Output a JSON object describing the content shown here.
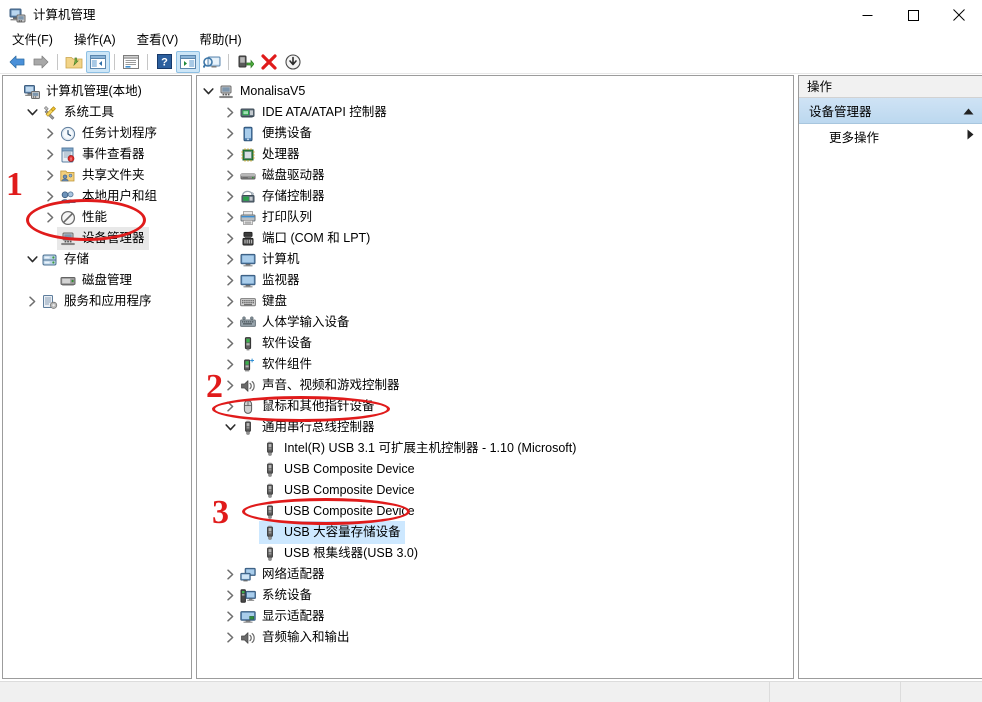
{
  "window": {
    "title": "计算机管理",
    "icon": "computer-management-icon",
    "controls": {
      "minimize": "minimize-icon",
      "maximize": "maximize-icon",
      "close": "close-icon"
    }
  },
  "menubar": {
    "items": [
      {
        "label": "文件(F)",
        "text": "文件(",
        "accel": "F",
        "tail": ")"
      },
      {
        "label": "操作(A)",
        "text": "操作(",
        "accel": "A",
        "tail": ")"
      },
      {
        "label": "查看(V)",
        "text": "查看(",
        "accel": "V",
        "tail": ")"
      },
      {
        "label": "帮助(H)",
        "text": "帮助(",
        "accel": "H",
        "tail": ")"
      }
    ]
  },
  "toolbar": {
    "buttons": [
      {
        "name": "back-icon",
        "state": "normal"
      },
      {
        "name": "forward-icon",
        "state": "normal"
      },
      {
        "name": "separator",
        "state": "sep"
      },
      {
        "name": "up-folder-icon",
        "state": "normal"
      },
      {
        "name": "show-hide-console-tree-icon",
        "state": "active"
      },
      {
        "name": "separator",
        "state": "sep"
      },
      {
        "name": "properties-icon",
        "state": "normal"
      },
      {
        "name": "separator",
        "state": "sep"
      },
      {
        "name": "help-icon",
        "state": "normal"
      },
      {
        "name": "show-hide-action-pane-icon",
        "state": "active"
      },
      {
        "name": "scan-hardware-changes-icon",
        "state": "normal"
      },
      {
        "name": "separator",
        "state": "sep"
      },
      {
        "name": "update-driver-icon",
        "state": "normal"
      },
      {
        "name": "uninstall-device-icon",
        "state": "normal"
      },
      {
        "name": "disable-device-icon",
        "state": "normal"
      }
    ]
  },
  "console_tree": {
    "items": [
      {
        "label": "计算机管理(本地)",
        "depth": 0,
        "chevron": "none",
        "icon": "computer-management-icon",
        "selected": false
      },
      {
        "label": "系统工具",
        "depth": 1,
        "chevron": "down",
        "icon": "system-tools-icon",
        "selected": false
      },
      {
        "label": "任务计划程序",
        "depth": 2,
        "chevron": "right",
        "icon": "task-scheduler-icon",
        "selected": false
      },
      {
        "label": "事件查看器",
        "depth": 2,
        "chevron": "right",
        "icon": "event-viewer-icon",
        "selected": false
      },
      {
        "label": "共享文件夹",
        "depth": 2,
        "chevron": "right",
        "icon": "shared-folders-icon",
        "selected": false
      },
      {
        "label": "本地用户和组",
        "depth": 2,
        "chevron": "right",
        "icon": "local-users-groups-icon",
        "selected": false
      },
      {
        "label": "性能",
        "depth": 2,
        "chevron": "right",
        "icon": "performance-icon",
        "selected": false
      },
      {
        "label": "设备管理器",
        "depth": 2,
        "chevron": "none",
        "icon": "device-manager-icon",
        "selected": true
      },
      {
        "label": "存储",
        "depth": 1,
        "chevron": "down",
        "icon": "storage-icon",
        "selected": false
      },
      {
        "label": "磁盘管理",
        "depth": 2,
        "chevron": "none",
        "icon": "disk-management-icon",
        "selected": false
      },
      {
        "label": "服务和应用程序",
        "depth": 1,
        "chevron": "right",
        "icon": "services-applications-icon",
        "selected": false
      }
    ]
  },
  "device_tree": {
    "items": [
      {
        "label": "MonalisaV5",
        "depth": 0,
        "chevron": "down",
        "icon": "computer-icon",
        "selected": false
      },
      {
        "label": "IDE ATA/ATAPI 控制器",
        "depth": 1,
        "chevron": "right",
        "icon": "ide-controller-icon",
        "selected": false
      },
      {
        "label": "便携设备",
        "depth": 1,
        "chevron": "right",
        "icon": "portable-device-icon",
        "selected": false
      },
      {
        "label": "处理器",
        "depth": 1,
        "chevron": "right",
        "icon": "processor-icon",
        "selected": false
      },
      {
        "label": "磁盘驱动器",
        "depth": 1,
        "chevron": "right",
        "icon": "disk-drive-icon",
        "selected": false
      },
      {
        "label": "存储控制器",
        "depth": 1,
        "chevron": "right",
        "icon": "storage-controller-icon",
        "selected": false
      },
      {
        "label": "打印队列",
        "depth": 1,
        "chevron": "right",
        "icon": "print-queue-icon",
        "selected": false
      },
      {
        "label": "端口 (COM 和 LPT)",
        "depth": 1,
        "chevron": "right",
        "icon": "ports-icon",
        "selected": false
      },
      {
        "label": "计算机",
        "depth": 1,
        "chevron": "right",
        "icon": "monitor-icon",
        "selected": false
      },
      {
        "label": "监视器",
        "depth": 1,
        "chevron": "right",
        "icon": "monitor-icon",
        "selected": false
      },
      {
        "label": "键盘",
        "depth": 1,
        "chevron": "right",
        "icon": "keyboard-icon",
        "selected": false
      },
      {
        "label": "人体学输入设备",
        "depth": 1,
        "chevron": "right",
        "icon": "hid-icon",
        "selected": false
      },
      {
        "label": "软件设备",
        "depth": 1,
        "chevron": "right",
        "icon": "software-device-icon",
        "selected": false
      },
      {
        "label": "软件组件",
        "depth": 1,
        "chevron": "right",
        "icon": "software-component-icon",
        "selected": false
      },
      {
        "label": "声音、视频和游戏控制器",
        "depth": 1,
        "chevron": "right",
        "icon": "sound-video-game-icon",
        "selected": false
      },
      {
        "label": "鼠标和其他指针设备",
        "depth": 1,
        "chevron": "right",
        "icon": "mouse-icon",
        "selected": false
      },
      {
        "label": "通用串行总线控制器",
        "depth": 1,
        "chevron": "down",
        "icon": "usb-controller-icon",
        "selected": false
      },
      {
        "label": "Intel(R) USB 3.1 可扩展主机控制器 - 1.10 (Microsoft)",
        "depth": 2,
        "chevron": "none",
        "icon": "usb-device-icon",
        "selected": false
      },
      {
        "label": "USB Composite Device",
        "depth": 2,
        "chevron": "none",
        "icon": "usb-device-icon",
        "selected": false
      },
      {
        "label": "USB Composite Device",
        "depth": 2,
        "chevron": "none",
        "icon": "usb-device-icon",
        "selected": false
      },
      {
        "label": "USB Composite Device",
        "depth": 2,
        "chevron": "none",
        "icon": "usb-device-icon",
        "selected": false
      },
      {
        "label": "USB 大容量存储设备",
        "depth": 2,
        "chevron": "none",
        "icon": "usb-device-icon",
        "selected": true
      },
      {
        "label": "USB 根集线器(USB 3.0)",
        "depth": 2,
        "chevron": "none",
        "icon": "usb-device-icon",
        "selected": false
      },
      {
        "label": "网络适配器",
        "depth": 1,
        "chevron": "right",
        "icon": "network-adapter-icon",
        "selected": false
      },
      {
        "label": "系统设备",
        "depth": 1,
        "chevron": "right",
        "icon": "system-device-icon",
        "selected": false
      },
      {
        "label": "显示适配器",
        "depth": 1,
        "chevron": "right",
        "icon": "display-adapter-icon",
        "selected": false
      },
      {
        "label": "音频输入和输出",
        "depth": 1,
        "chevron": "right",
        "icon": "audio-io-icon",
        "selected": false
      }
    ]
  },
  "action_pane": {
    "header": "操作",
    "group_title": "设备管理器",
    "group_collapse_icon": "chevron-up-icon",
    "items": [
      {
        "label": "更多操作",
        "submenu_icon": "chevron-right-icon"
      }
    ]
  },
  "annotations": {
    "accent_color": "#e01b1b",
    "marks": [
      {
        "number": "1",
        "target": "console-tree-device-manager"
      },
      {
        "number": "2",
        "target": "usb-controllers-node"
      },
      {
        "number": "3",
        "target": "usb-mass-storage-device"
      }
    ]
  },
  "statusbar": {
    "cells": [
      "",
      "",
      ""
    ]
  },
  "colors": {
    "selection_blue": "#cde8ff",
    "selection_gray": "#e8e8e8",
    "action_group_bg": "#c6dcf0",
    "panel_border": "#9c9c9c",
    "annotation_red": "#e01b1b"
  }
}
